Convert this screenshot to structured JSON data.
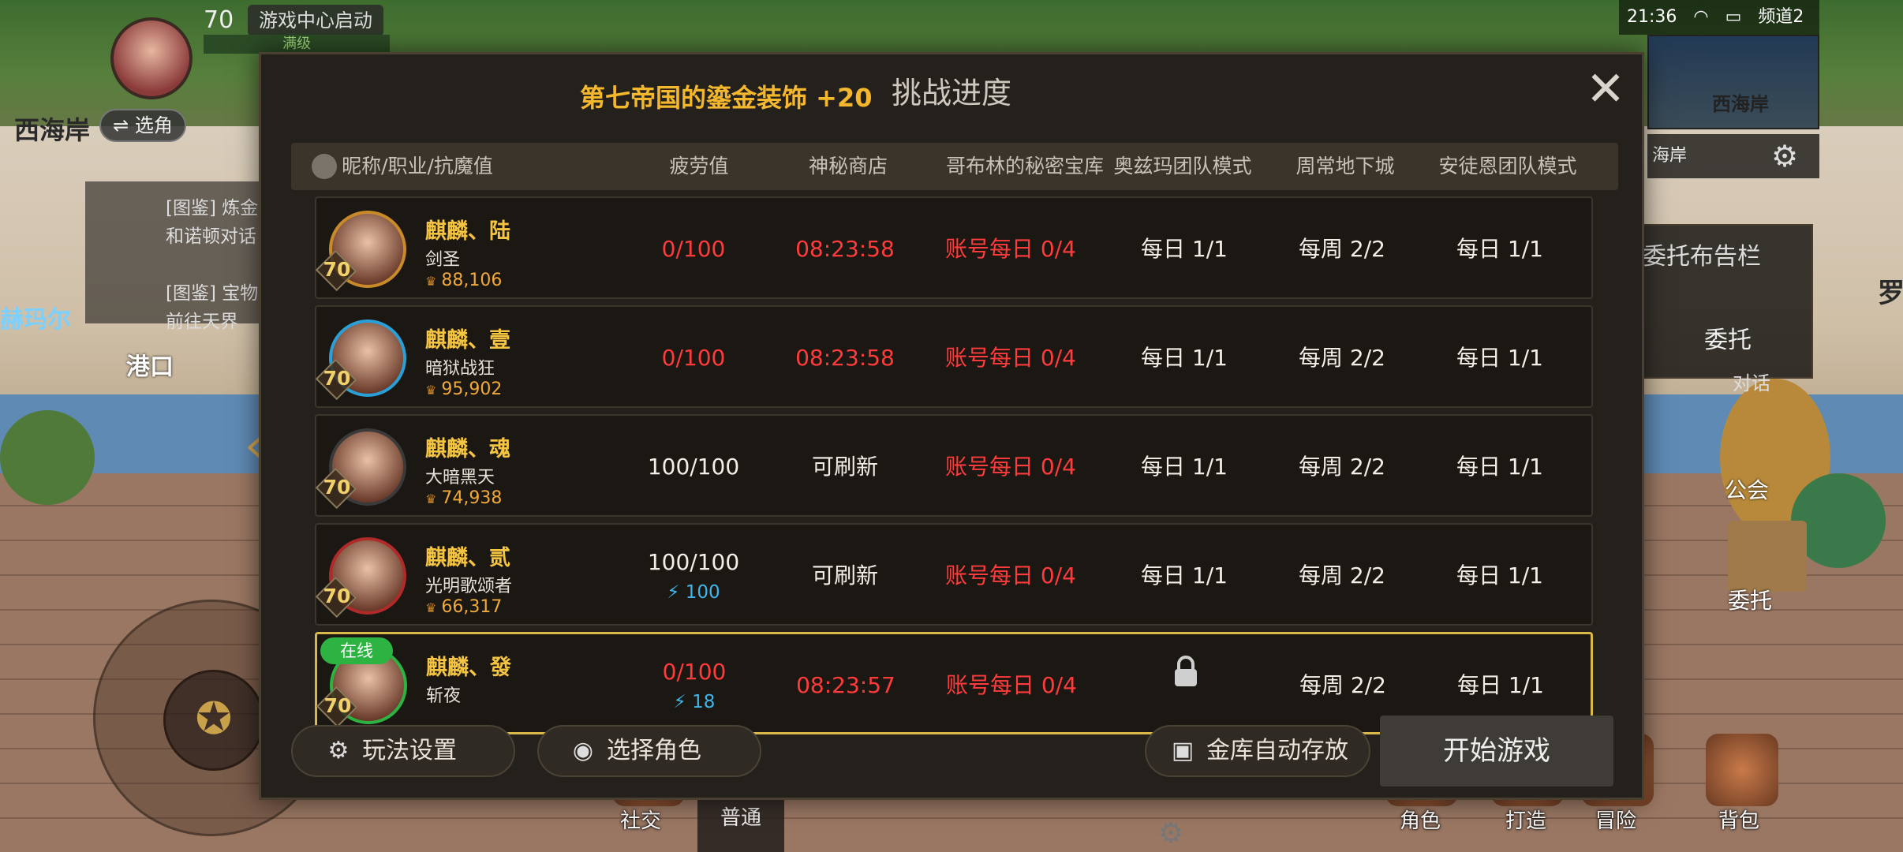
{
  "hud": {
    "level": "70",
    "game_center": "游戏中心启动",
    "full_level": "满级",
    "switch_role": "⇌ 选角",
    "region": "西海岸",
    "time": "21:36",
    "channel": "频道2",
    "minimap_label": "西海岸",
    "minimap_location": "海岸",
    "side_board": "委托布告栏",
    "side_entrust": "委托",
    "dialog_tag": "对话",
    "sign_guild": "公会",
    "sign_entrust": "委托",
    "far_name": "罗",
    "quest_a": "[图鉴] 炼金",
    "quest_b": "和诺顿对话",
    "quest_c": "[图鉴] 宝物",
    "quest_d": "前往天界",
    "town_label": "港口",
    "town_label2": "赫玛尔"
  },
  "bottom": {
    "social": "社交",
    "normal": "普通",
    "role": "角色",
    "craft": "打造",
    "adventure": "冒险",
    "bag": "背包"
  },
  "modal": {
    "title": "挑战进度",
    "reward": "第七帝国的鎏金装饰 +20",
    "headers": [
      "昵称/职业/抗魔值",
      "疲劳值",
      "神秘商店",
      "哥布林的秘密宝库",
      "奥兹玛团队模式",
      "周常地下城",
      "安徒恩团队模式"
    ],
    "rows": [
      {
        "name": "麒麟、陆",
        "class": "剑圣",
        "power": "88,106",
        "level": "70",
        "fatigue": "0/100",
        "energy": "",
        "shop": "08:23:58",
        "shop_red": true,
        "goblin": "账号每日 0/4",
        "ozma": "每日 1/1",
        "weekly": "每周 2/2",
        "anton": "每日 1/1",
        "online": "",
        "avatar_color": "#c98a2a",
        "locked": false
      },
      {
        "name": "麒麟、壹",
        "class": "暗狱战狂",
        "power": "95,902",
        "level": "70",
        "fatigue": "0/100",
        "energy": "",
        "shop": "08:23:58",
        "shop_red": true,
        "goblin": "账号每日 0/4",
        "ozma": "每日 1/1",
        "weekly": "每周 2/2",
        "anton": "每日 1/1",
        "online": "",
        "avatar_color": "#2aa0d8",
        "locked": false
      },
      {
        "name": "麒麟、魂",
        "class": "大暗黑天",
        "power": "74,938",
        "level": "70",
        "fatigue": "100/100",
        "energy": "",
        "shop": "可刷新",
        "shop_red": false,
        "goblin": "账号每日 0/4",
        "ozma": "每日 1/1",
        "weekly": "每周 2/2",
        "anton": "每日 1/1",
        "online": "",
        "avatar_color": "#3a3a3a",
        "locked": false
      },
      {
        "name": "麒麟、贰",
        "class": "光明歌颂者",
        "power": "66,317",
        "level": "70",
        "fatigue": "100/100",
        "energy": "⚡ 100",
        "shop": "可刷新",
        "shop_red": false,
        "goblin": "账号每日 0/4",
        "ozma": "每日 1/1",
        "weekly": "每周 2/2",
        "anton": "每日 1/1",
        "online": "",
        "avatar_color": "#b02a2a",
        "locked": false
      },
      {
        "name": "麒麟、發",
        "class": "斩夜",
        "power": "",
        "level": "70",
        "fatigue": "0/100",
        "energy": "⚡ 18",
        "shop": "08:23:57",
        "shop_red": true,
        "goblin": "账号每日 0/4",
        "ozma": "",
        "weekly": "每周 2/2",
        "anton": "每日 1/1",
        "online": "在线",
        "avatar_color": "#2db341",
        "locked": true
      }
    ],
    "btn_settings": "玩法设置",
    "btn_select_role": "选择角色",
    "btn_vault": "金库自动存放",
    "btn_start": "开始游戏"
  }
}
